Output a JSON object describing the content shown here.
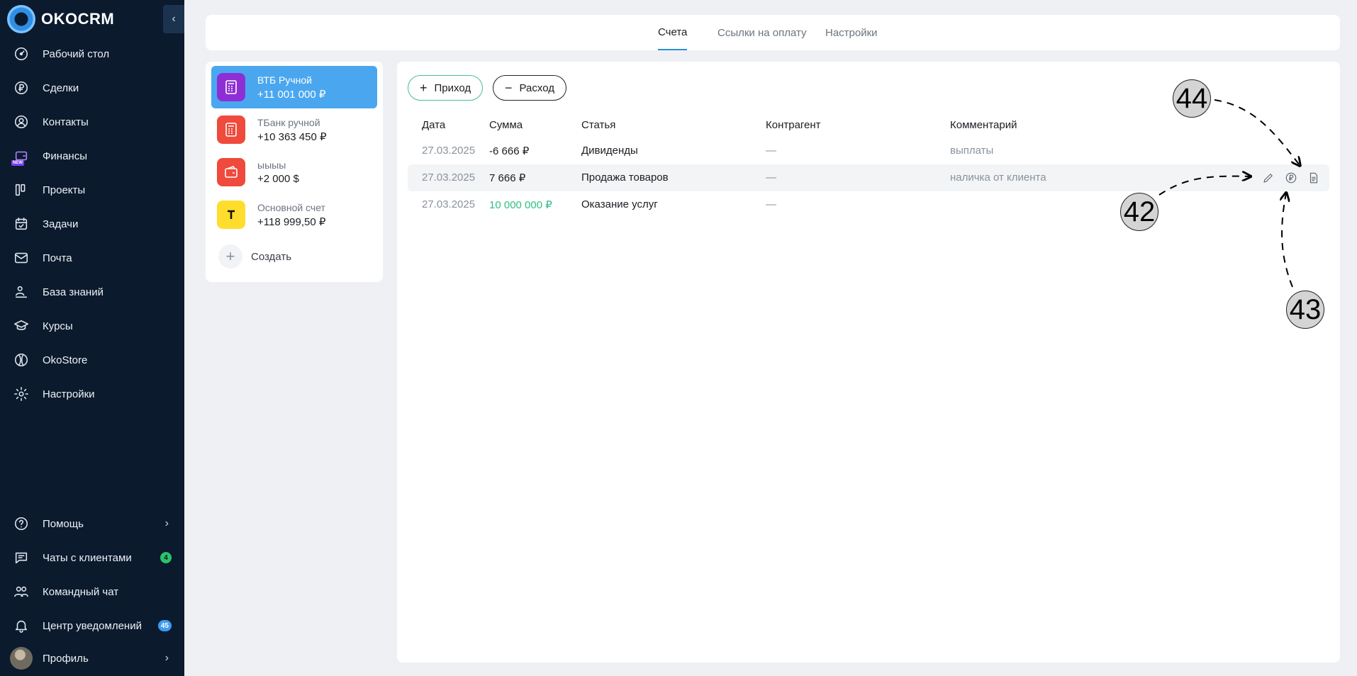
{
  "brand": {
    "name": "OKOCRM"
  },
  "sidebar": {
    "items": [
      {
        "label": "Рабочий стол",
        "icon": "dashboard-icon"
      },
      {
        "label": "Сделки",
        "icon": "ruble-circle-icon"
      },
      {
        "label": "Контакты",
        "icon": "user-circle-icon"
      },
      {
        "label": "Финансы",
        "icon": "wallet-icon",
        "badge": "NEW"
      },
      {
        "label": "Проекты",
        "icon": "projects-icon"
      },
      {
        "label": "Задачи",
        "icon": "calendar-check-icon"
      },
      {
        "label": "Почта",
        "icon": "mail-icon"
      },
      {
        "label": "База знаний",
        "icon": "knowledge-icon"
      },
      {
        "label": "Курсы",
        "icon": "graduation-cap-icon"
      },
      {
        "label": "OkoStore",
        "icon": "store-globe-icon"
      },
      {
        "label": "Настройки",
        "icon": "gear-icon"
      }
    ],
    "bottom": [
      {
        "label": "Помощь",
        "icon": "help-icon"
      },
      {
        "label": "Чаты с клиентами",
        "icon": "chat-icon",
        "count": "4"
      },
      {
        "label": "Командный чат",
        "icon": "team-icon"
      },
      {
        "label": "Центр уведомлений",
        "icon": "bell-icon",
        "count": "45"
      },
      {
        "label": "Профиль",
        "icon": "avatar"
      }
    ]
  },
  "tabs": [
    "Счета",
    "Ссылки на оплату",
    "Настройки"
  ],
  "accounts": [
    {
      "name": "ВТБ Ручной",
      "sum": "+11 001 000 ₽",
      "color": "#8e2fd6"
    },
    {
      "name": "ТБанк ручной",
      "sum": "+10 363 450 ₽",
      "color": "#ef4a3c"
    },
    {
      "name": "ыыыы",
      "sum": "+2 000 $",
      "color": "#ef4a3c"
    },
    {
      "name": "Основной счет",
      "sum": "+118 999,50 ₽",
      "color": "#ffdd2d"
    }
  ],
  "create_label": "Создать",
  "actions": {
    "income": "Приход",
    "expense": "Расход"
  },
  "table": {
    "headers": [
      "Дата",
      "Сумма",
      "Статья",
      "Контрагент",
      "Комментарий"
    ],
    "rows": [
      {
        "date": "27.03.2025",
        "sum": "-6 666 ₽",
        "article": "Дивиденды",
        "counterparty": "—",
        "comment": "выплаты"
      },
      {
        "date": "27.03.2025",
        "sum": "7 666 ₽",
        "article": "Продажа товаров",
        "counterparty": "—",
        "comment": "наличка от клиента"
      },
      {
        "date": "27.03.2025",
        "sum": "10 000 000 ₽",
        "article": "Оказание услуг",
        "counterparty": "—",
        "comment": ""
      }
    ]
  },
  "annotations": [
    "44",
    "42",
    "43"
  ]
}
